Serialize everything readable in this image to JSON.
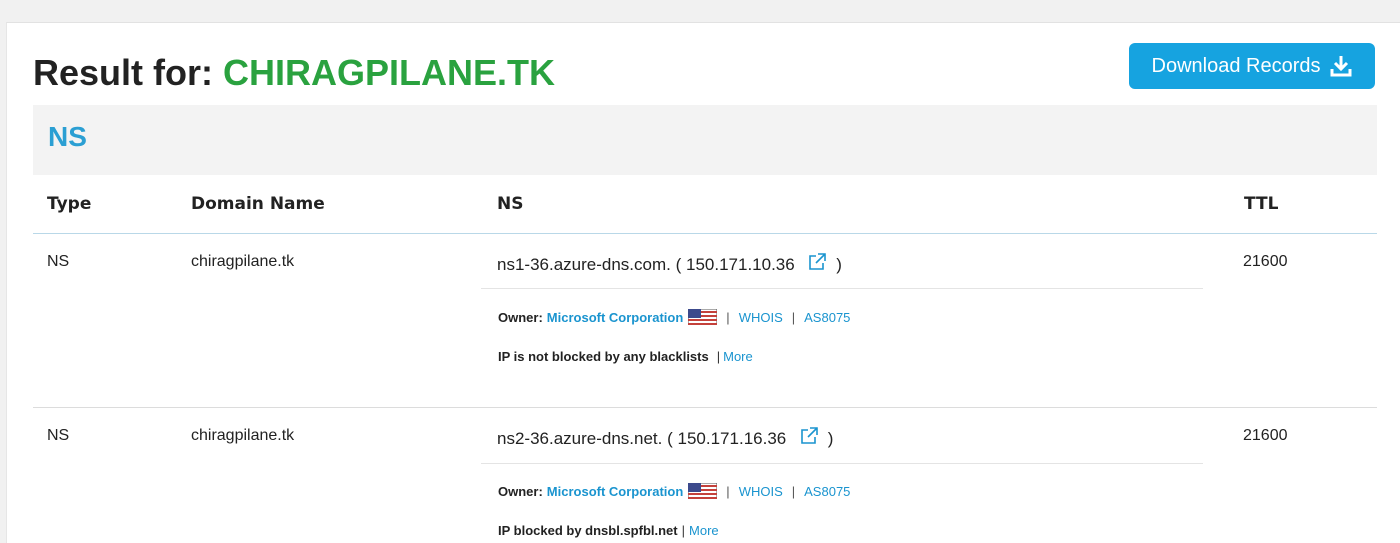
{
  "header": {
    "title_prefix": "Result for:",
    "title_domain": "CHIRAGPILANE.TK",
    "download_label": "Download Records"
  },
  "section": {
    "title": "NS"
  },
  "table": {
    "columns": [
      "Type",
      "Domain Name",
      "NS",
      "TTL"
    ],
    "rows": [
      {
        "type": "NS",
        "domain": "chiragpilane.tk",
        "ns_host": "ns1-36.azure-dns.com.",
        "ns_ip": "150.171.10.36",
        "ttl": "21600",
        "owner_label": "Owner:",
        "owner": "Microsoft Corporation",
        "whois": "WHOIS",
        "asn": "AS8075",
        "blacklist_text": "IP is not blocked by any blacklists",
        "more": "More"
      },
      {
        "type": "NS",
        "domain": "chiragpilane.tk",
        "ns_host": "ns2-36.azure-dns.net.",
        "ns_ip": "150.171.16.36",
        "ttl": "21600",
        "owner_label": "Owner:",
        "owner": "Microsoft Corporation",
        "whois": "WHOIS",
        "asn": "AS8075",
        "blacklist_text": "IP blocked by dnsbl.spfbl.net",
        "more": "More"
      }
    ]
  },
  "colors": {
    "accent_blue": "#16a3e0",
    "link_blue": "#1a94cf",
    "domain_green": "#2aa23f"
  },
  "icons": {
    "download": "download-icon",
    "external_link": "external-link-icon",
    "flag": "us-flag-icon"
  }
}
